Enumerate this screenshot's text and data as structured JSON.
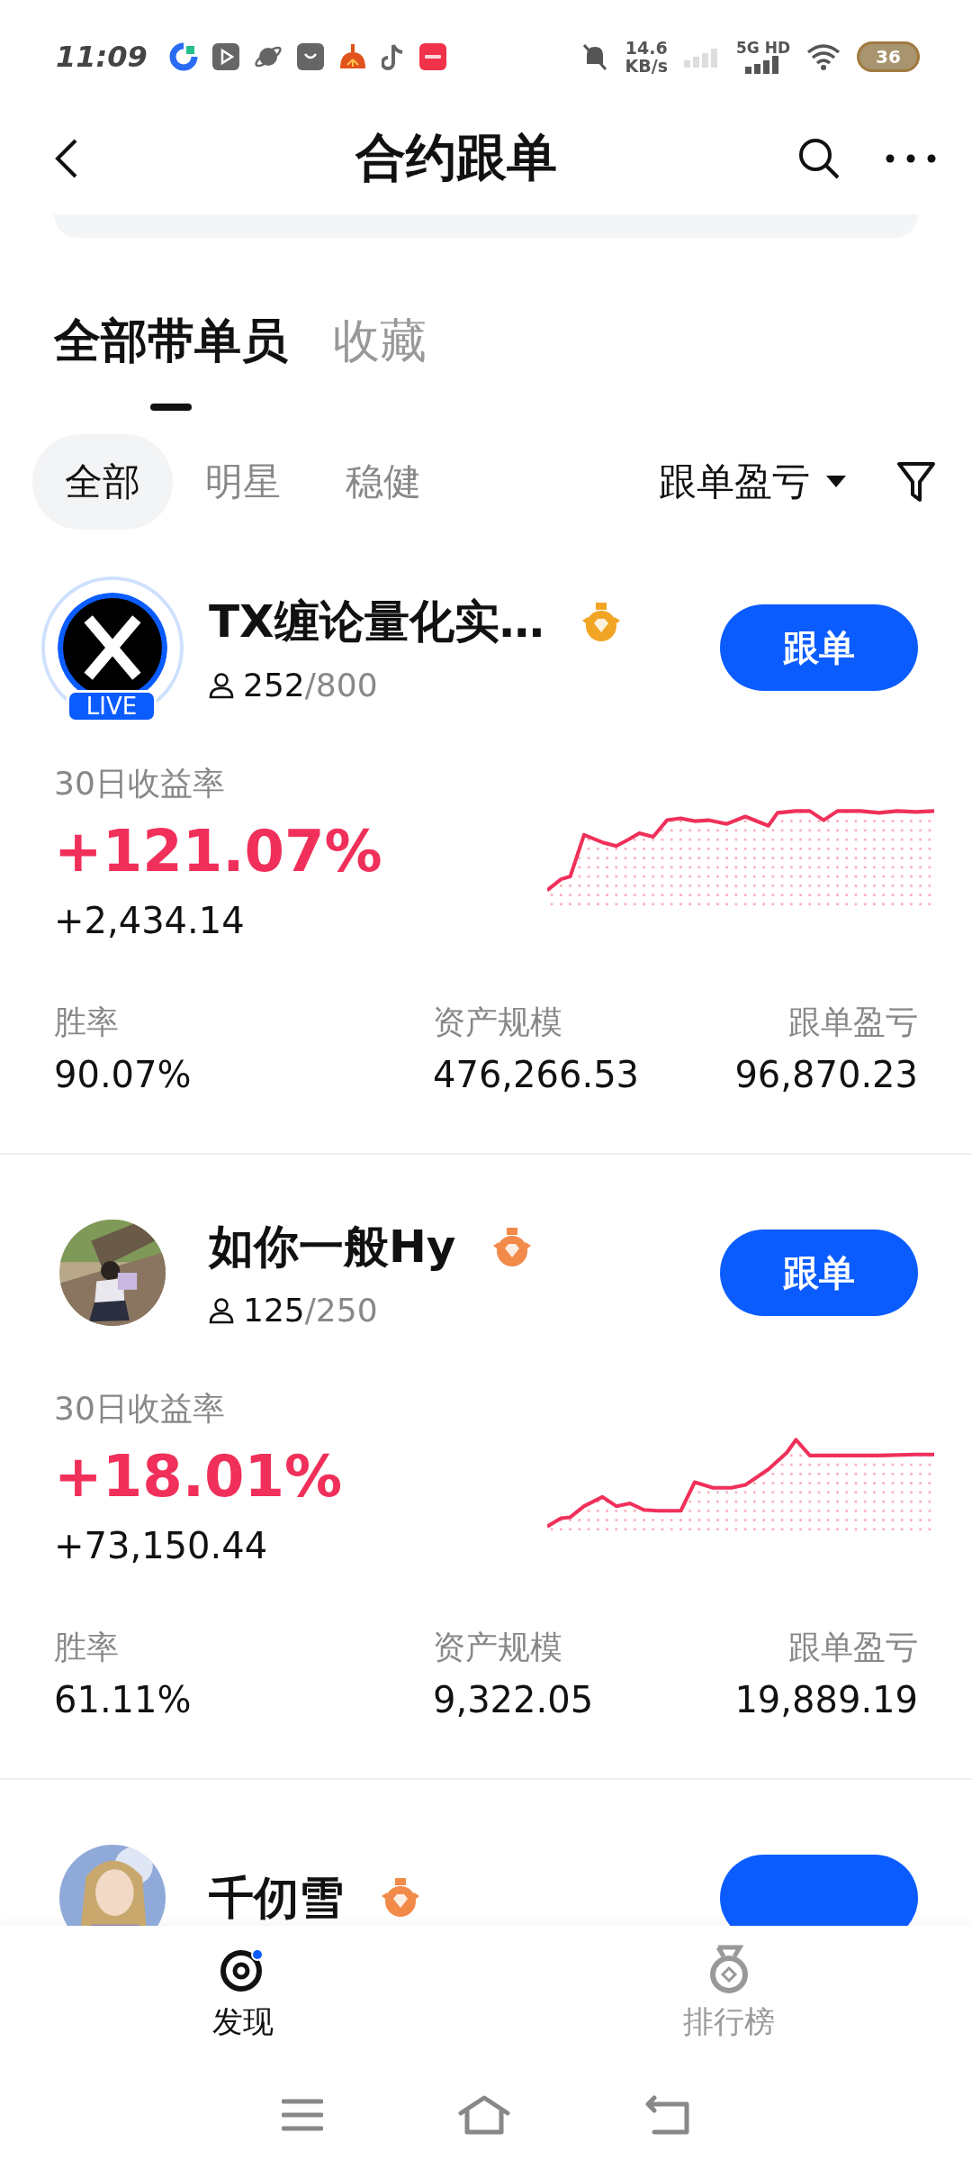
{
  "status_bar": {
    "time": "11:09",
    "speed_value": "14.6",
    "speed_unit": "KB/s",
    "network": "5G HD",
    "battery": "36"
  },
  "header": {
    "title": "合约跟单"
  },
  "tabs": [
    {
      "label": "全部带单员",
      "selected": true
    },
    {
      "label": "收藏",
      "selected": false
    }
  ],
  "filters": [
    {
      "label": "全部",
      "selected": true
    },
    {
      "label": "明星",
      "selected": false
    },
    {
      "label": "稳健",
      "selected": false
    }
  ],
  "sort": {
    "label": "跟单盈亏"
  },
  "traders": [
    {
      "name": "TX缠论量化实…",
      "avatar": {
        "kind": "logo"
      },
      "live": true,
      "live_label": "LIVE",
      "medal": {
        "color": "#f2a524"
      },
      "followers": "252",
      "capacity": "/800",
      "button": "跟单",
      "return_label": "30日收益率",
      "return_rate": "+121.07%",
      "return_amount": "+2,434.14",
      "stats": [
        {
          "label": "胜率",
          "value": "90.07%"
        },
        {
          "label": "资产规模",
          "value": "476,266.53"
        },
        {
          "label": "跟单盈亏",
          "value": "96,870.23"
        }
      ]
    },
    {
      "name": "如你一般Hy",
      "live": false,
      "medal": {
        "color": "#f28a4a"
      },
      "followers": "125",
      "capacity": "/250",
      "button": "跟单",
      "return_label": "30日收益率",
      "return_rate": "+18.01%",
      "return_amount": "+73,150.44",
      "stats": [
        {
          "label": "胜率",
          "value": "61.11%"
        },
        {
          "label": "资产规模",
          "value": "9,322.05"
        },
        {
          "label": "跟单盈亏",
          "value": "19,889.19"
        }
      ]
    },
    {
      "name": "千仞雪",
      "live": false,
      "medal": {
        "color": "#f28a4a"
      }
    }
  ],
  "bottom_nav": [
    {
      "label": "发现",
      "selected": true
    },
    {
      "label": "排行榜",
      "selected": false
    }
  ]
}
